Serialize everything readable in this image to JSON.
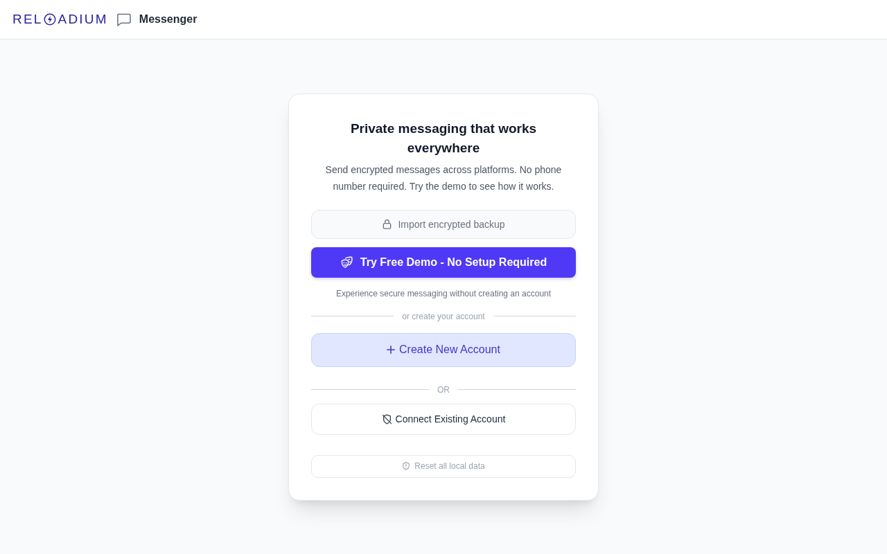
{
  "header": {
    "logo_start": "REL",
    "logo_end": "ADIUM",
    "app_name": "Messenger"
  },
  "card": {
    "title": "Private messaging that works everywhere",
    "subtitle": "Send encrypted messages across platforms. No phone number required. Try the demo to see how it works.",
    "import_button": {
      "label": "Import encrypted backup"
    },
    "demo_button": {
      "label": "Try Free Demo - No Setup Required"
    },
    "demo_note": "Experience secure messaging without creating an account",
    "create_divider": "or create your account",
    "create_button": {
      "label": "Create New Account"
    },
    "or_divider": "OR",
    "connect_button": {
      "label": "Connect Existing Account"
    },
    "reset_button": {
      "label": "Reset all local data"
    }
  }
}
